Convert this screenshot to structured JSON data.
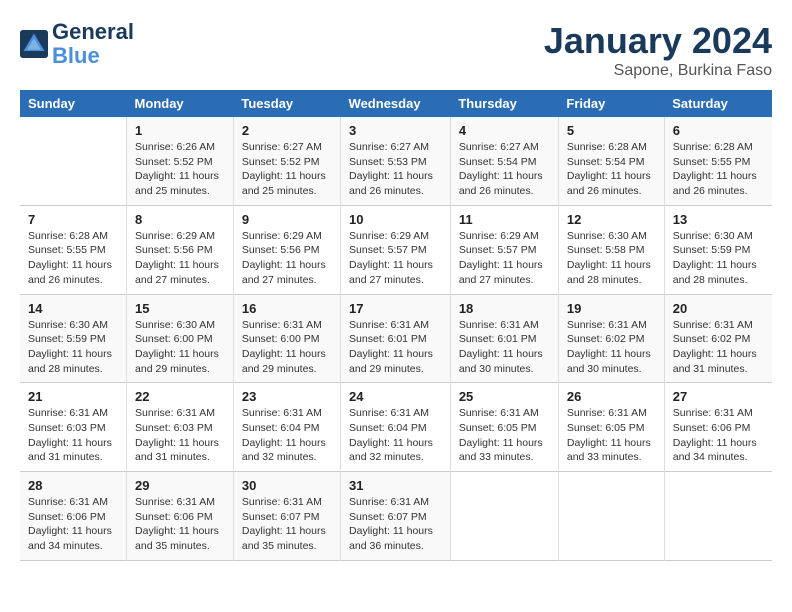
{
  "logo": {
    "line1": "General",
    "line2": "Blue"
  },
  "title": "January 2024",
  "subtitle": "Sapone, Burkina Faso",
  "days_header": [
    "Sunday",
    "Monday",
    "Tuesday",
    "Wednesday",
    "Thursday",
    "Friday",
    "Saturday"
  ],
  "weeks": [
    [
      {
        "num": "",
        "info": ""
      },
      {
        "num": "1",
        "info": "Sunrise: 6:26 AM\nSunset: 5:52 PM\nDaylight: 11 hours\nand 25 minutes."
      },
      {
        "num": "2",
        "info": "Sunrise: 6:27 AM\nSunset: 5:52 PM\nDaylight: 11 hours\nand 25 minutes."
      },
      {
        "num": "3",
        "info": "Sunrise: 6:27 AM\nSunset: 5:53 PM\nDaylight: 11 hours\nand 26 minutes."
      },
      {
        "num": "4",
        "info": "Sunrise: 6:27 AM\nSunset: 5:54 PM\nDaylight: 11 hours\nand 26 minutes."
      },
      {
        "num": "5",
        "info": "Sunrise: 6:28 AM\nSunset: 5:54 PM\nDaylight: 11 hours\nand 26 minutes."
      },
      {
        "num": "6",
        "info": "Sunrise: 6:28 AM\nSunset: 5:55 PM\nDaylight: 11 hours\nand 26 minutes."
      }
    ],
    [
      {
        "num": "7",
        "info": "Sunrise: 6:28 AM\nSunset: 5:55 PM\nDaylight: 11 hours\nand 26 minutes."
      },
      {
        "num": "8",
        "info": "Sunrise: 6:29 AM\nSunset: 5:56 PM\nDaylight: 11 hours\nand 27 minutes."
      },
      {
        "num": "9",
        "info": "Sunrise: 6:29 AM\nSunset: 5:56 PM\nDaylight: 11 hours\nand 27 minutes."
      },
      {
        "num": "10",
        "info": "Sunrise: 6:29 AM\nSunset: 5:57 PM\nDaylight: 11 hours\nand 27 minutes."
      },
      {
        "num": "11",
        "info": "Sunrise: 6:29 AM\nSunset: 5:57 PM\nDaylight: 11 hours\nand 27 minutes."
      },
      {
        "num": "12",
        "info": "Sunrise: 6:30 AM\nSunset: 5:58 PM\nDaylight: 11 hours\nand 28 minutes."
      },
      {
        "num": "13",
        "info": "Sunrise: 6:30 AM\nSunset: 5:59 PM\nDaylight: 11 hours\nand 28 minutes."
      }
    ],
    [
      {
        "num": "14",
        "info": "Sunrise: 6:30 AM\nSunset: 5:59 PM\nDaylight: 11 hours\nand 28 minutes."
      },
      {
        "num": "15",
        "info": "Sunrise: 6:30 AM\nSunset: 6:00 PM\nDaylight: 11 hours\nand 29 minutes."
      },
      {
        "num": "16",
        "info": "Sunrise: 6:31 AM\nSunset: 6:00 PM\nDaylight: 11 hours\nand 29 minutes."
      },
      {
        "num": "17",
        "info": "Sunrise: 6:31 AM\nSunset: 6:01 PM\nDaylight: 11 hours\nand 29 minutes."
      },
      {
        "num": "18",
        "info": "Sunrise: 6:31 AM\nSunset: 6:01 PM\nDaylight: 11 hours\nand 30 minutes."
      },
      {
        "num": "19",
        "info": "Sunrise: 6:31 AM\nSunset: 6:02 PM\nDaylight: 11 hours\nand 30 minutes."
      },
      {
        "num": "20",
        "info": "Sunrise: 6:31 AM\nSunset: 6:02 PM\nDaylight: 11 hours\nand 31 minutes."
      }
    ],
    [
      {
        "num": "21",
        "info": "Sunrise: 6:31 AM\nSunset: 6:03 PM\nDaylight: 11 hours\nand 31 minutes."
      },
      {
        "num": "22",
        "info": "Sunrise: 6:31 AM\nSunset: 6:03 PM\nDaylight: 11 hours\nand 31 minutes."
      },
      {
        "num": "23",
        "info": "Sunrise: 6:31 AM\nSunset: 6:04 PM\nDaylight: 11 hours\nand 32 minutes."
      },
      {
        "num": "24",
        "info": "Sunrise: 6:31 AM\nSunset: 6:04 PM\nDaylight: 11 hours\nand 32 minutes."
      },
      {
        "num": "25",
        "info": "Sunrise: 6:31 AM\nSunset: 6:05 PM\nDaylight: 11 hours\nand 33 minutes."
      },
      {
        "num": "26",
        "info": "Sunrise: 6:31 AM\nSunset: 6:05 PM\nDaylight: 11 hours\nand 33 minutes."
      },
      {
        "num": "27",
        "info": "Sunrise: 6:31 AM\nSunset: 6:06 PM\nDaylight: 11 hours\nand 34 minutes."
      }
    ],
    [
      {
        "num": "28",
        "info": "Sunrise: 6:31 AM\nSunset: 6:06 PM\nDaylight: 11 hours\nand 34 minutes."
      },
      {
        "num": "29",
        "info": "Sunrise: 6:31 AM\nSunset: 6:06 PM\nDaylight: 11 hours\nand 35 minutes."
      },
      {
        "num": "30",
        "info": "Sunrise: 6:31 AM\nSunset: 6:07 PM\nDaylight: 11 hours\nand 35 minutes."
      },
      {
        "num": "31",
        "info": "Sunrise: 6:31 AM\nSunset: 6:07 PM\nDaylight: 11 hours\nand 36 minutes."
      },
      {
        "num": "",
        "info": ""
      },
      {
        "num": "",
        "info": ""
      },
      {
        "num": "",
        "info": ""
      }
    ]
  ]
}
